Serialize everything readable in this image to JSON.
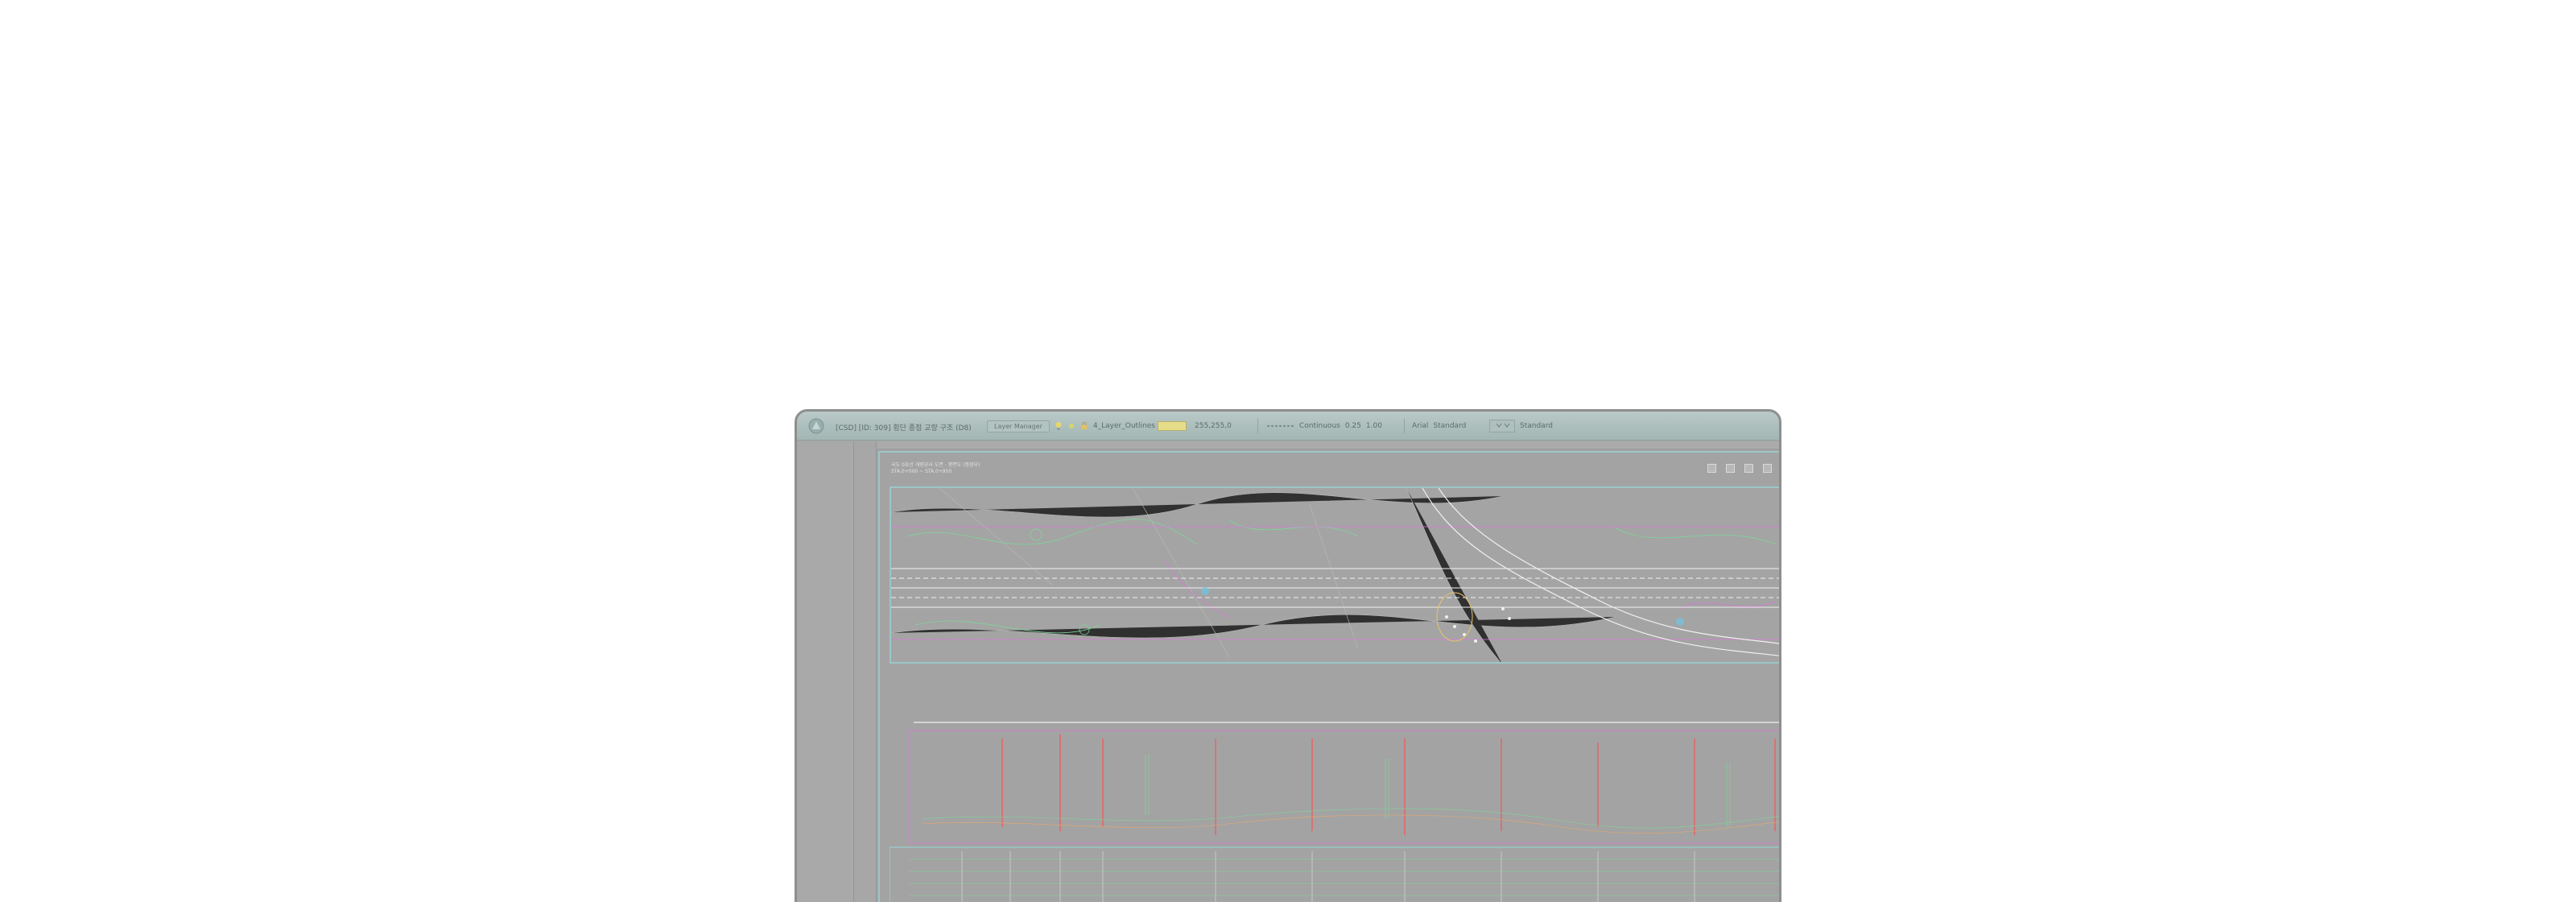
{
  "titlebar": {
    "document_title": "[CSD] [ID: 309] 횡단 종점 교량 구조 (D8)",
    "layer_manager_button": "Layer Manager",
    "layer_name": "4_Layer_Outlines",
    "color_value": "255,255,0",
    "linetype_name": "Continuous",
    "lineweight": "0.25",
    "linetype_scale": "1.00",
    "font_label": "Arial",
    "text_style": "Standard",
    "dim_style": "Standard"
  },
  "sheet": {
    "title_line1": "국도 0호선 개량공사 도면 - 평면도 (종점부)",
    "title_line2": "STA.0+000 ~ STA.0+950"
  },
  "colors": {
    "cad_cyan": "#9bc6c6",
    "cad_green": "#6fd38c",
    "cad_magenta": "#d46ad7",
    "cad_red": "#e06868",
    "cad_white": "#f2f2f2",
    "swatch_yellow": "#e6dd8a"
  },
  "icons": [
    "app-icon",
    "layer-bulb-icon",
    "layer-sun-icon",
    "layer-lock-icon",
    "linetype-icon",
    "dropdown-icon",
    "zoom-extents-icon",
    "layout-icon",
    "plot-icon",
    "settings-icon"
  ]
}
